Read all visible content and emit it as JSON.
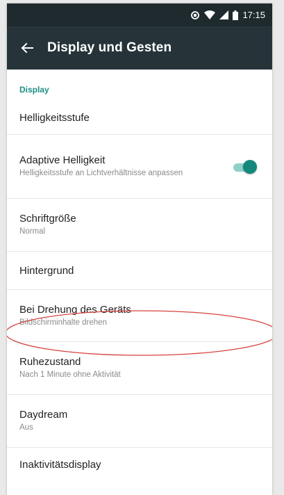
{
  "status_bar": {
    "time": "17:15",
    "icons": [
      "sync-icon",
      "wifi-icon",
      "signal-icon",
      "battery-icon"
    ]
  },
  "app_bar": {
    "back_icon": "arrow-back-icon",
    "title": "Display und Gesten"
  },
  "section": {
    "header": "Display"
  },
  "settings": [
    {
      "title": "Helligkeitsstufe",
      "summary": ""
    },
    {
      "title": "Adaptive Helligkeit",
      "summary": "Helligkeitsstufe an Lichtverhältnisse anpassen",
      "toggle_on": true
    },
    {
      "title": "Schriftgröße",
      "summary": "Normal"
    },
    {
      "title": "Hintergrund",
      "summary": ""
    },
    {
      "title": "Bei Drehung des Geräts",
      "summary": "Bildschirminhalte drehen"
    },
    {
      "title": "Ruhezustand",
      "summary": "Nach 1 Minute ohne Aktivität"
    },
    {
      "title": "Daydream",
      "summary": "Aus"
    },
    {
      "title": "Inaktivitätsdisplay",
      "summary": ""
    }
  ],
  "colors": {
    "status_bar": "#1f2a2e",
    "app_bar": "#26343a",
    "accent": "#1c8f83",
    "toggle_thumb": "#14887a",
    "toggle_track": "#8fd1c8",
    "highlight": "#d6423f"
  }
}
